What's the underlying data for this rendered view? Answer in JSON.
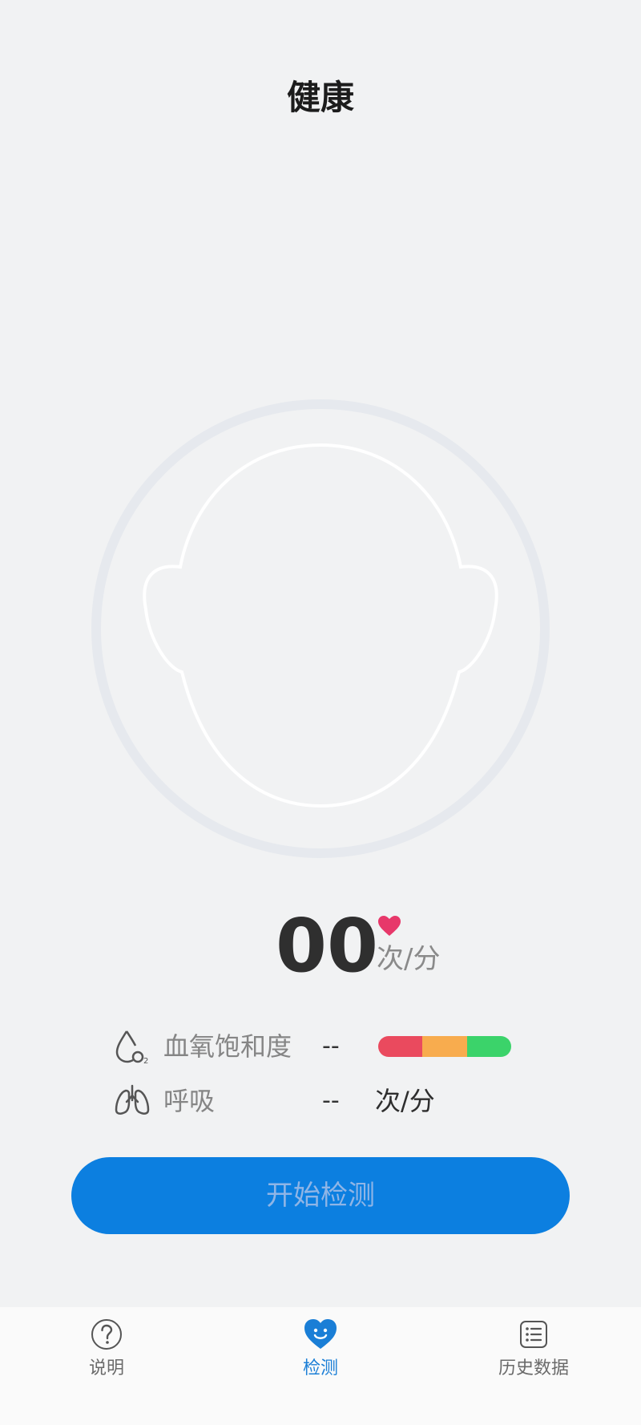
{
  "header": {
    "title": "健康"
  },
  "heart_rate": {
    "value": "00",
    "unit": "次/分"
  },
  "metrics": {
    "spo2": {
      "label": "血氧饱和度",
      "value": "--",
      "bar_colors": [
        "#ea4a5e",
        "#f8ac4e",
        "#3bd36a"
      ]
    },
    "respiration": {
      "label": "呼吸",
      "value": "--",
      "unit": "次/分"
    }
  },
  "start_button": {
    "label": "开始检测"
  },
  "tabbar": {
    "tabs": [
      {
        "label": "说明",
        "icon": "question-icon",
        "active": false
      },
      {
        "label": "检测",
        "icon": "smile-heart-icon",
        "active": true
      },
      {
        "label": "历史数据",
        "icon": "list-icon",
        "active": false
      }
    ]
  },
  "colors": {
    "accent": "#0c7fe0",
    "background": "#f1f2f3",
    "heart": "#e7386a"
  }
}
